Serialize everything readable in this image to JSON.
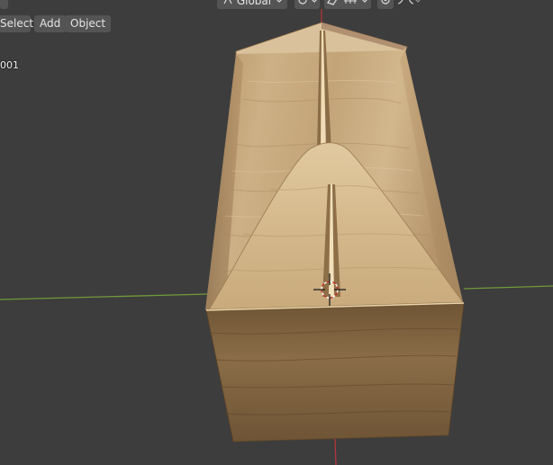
{
  "header": {
    "menu_select": "Select",
    "menu_add": "Add",
    "menu_object": "Object",
    "transform_orientation": "Global"
  },
  "viewport": {
    "object_label": "001",
    "background_color": "#3d3d3d",
    "x_axis_color": "#6f9a3a",
    "y_axis_color": "#b0373c"
  },
  "icons": [
    "pivot-icon",
    "dropdown-chevron-icon",
    "snap-magnet-icon",
    "snap-increment-icon",
    "proportional-editing-icon",
    "falloff-curve-icon",
    "orientation-icon"
  ]
}
